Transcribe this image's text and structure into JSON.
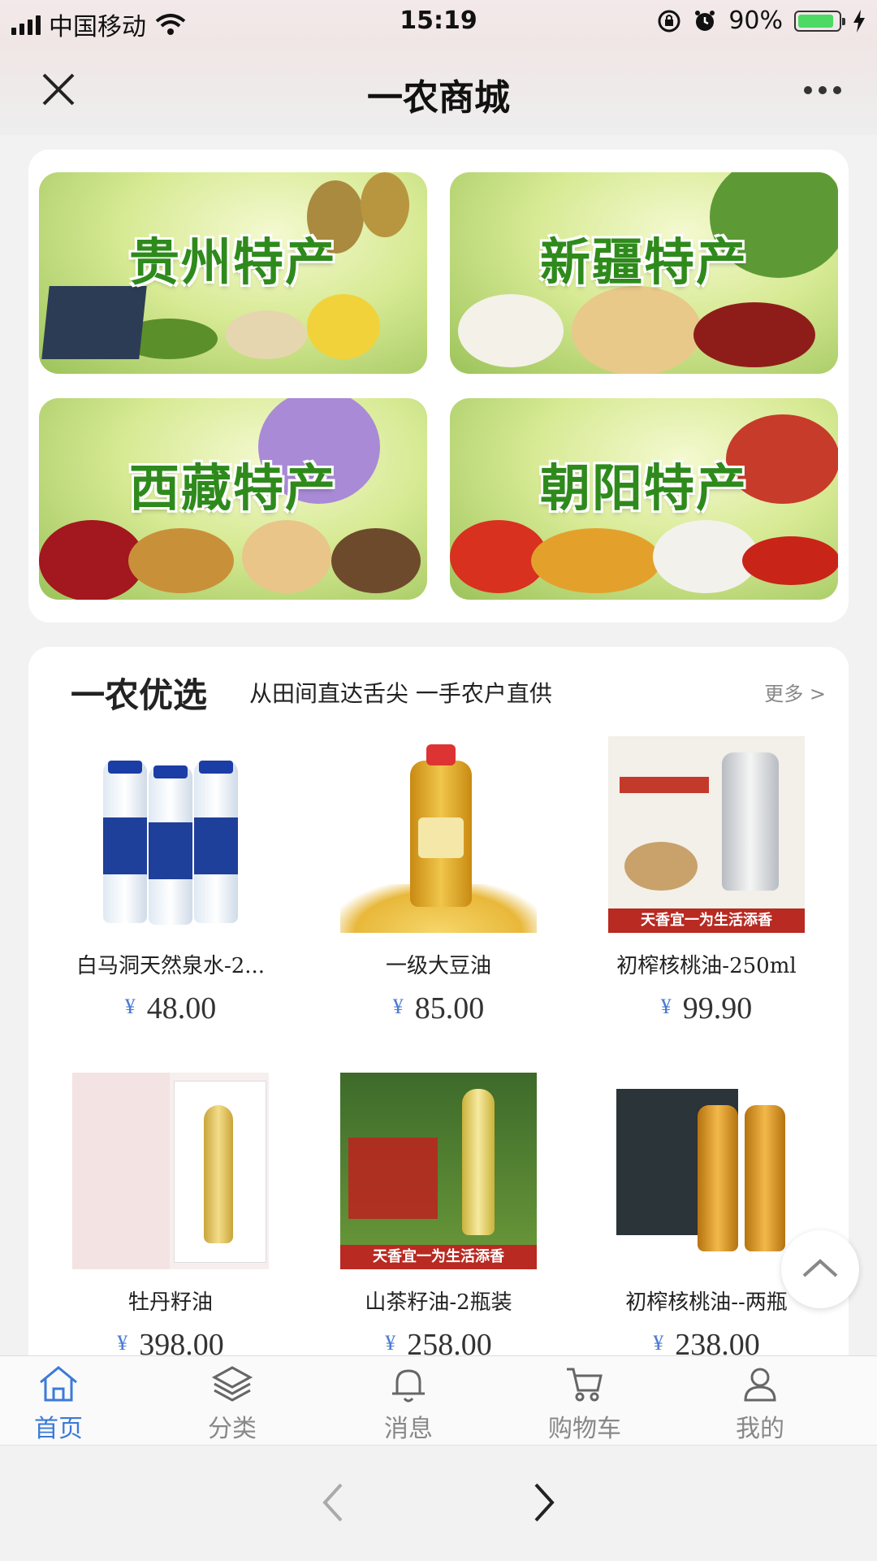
{
  "status_bar": {
    "carrier": "中国移动",
    "time": "15:19",
    "battery": "90%",
    "battery_level": 0.9
  },
  "nav": {
    "title": "一农商城"
  },
  "regions": [
    {
      "label": "贵州特产"
    },
    {
      "label": "新疆特产"
    },
    {
      "label": "西藏特产"
    },
    {
      "label": "朝阳特产"
    }
  ],
  "picks": {
    "title": "一农优选",
    "subtitle": "从田间直达舌尖 一手农户直供",
    "more": "更多 >",
    "banner_text": "天香宜一为生活添香",
    "products": [
      {
        "name": "白马洞天然泉水-2...",
        "currency": "¥",
        "price": "48.00"
      },
      {
        "name": "一级大豆油",
        "currency": "¥",
        "price": "85.00"
      },
      {
        "name": "初榨核桃油-250ml",
        "currency": "¥",
        "price": "99.90"
      },
      {
        "name": "牡丹籽油",
        "currency": "¥",
        "price": "398.00"
      },
      {
        "name": "山茶籽油-2瓶装",
        "currency": "¥",
        "price": "258.00"
      },
      {
        "name": "初榨核桃油--两瓶",
        "currency": "¥",
        "price": "238.00"
      }
    ]
  },
  "tabs": [
    {
      "label": "首页",
      "icon": "home-icon"
    },
    {
      "label": "分类",
      "icon": "layers-icon"
    },
    {
      "label": "消息",
      "icon": "bell-icon"
    },
    {
      "label": "购物车",
      "icon": "cart-icon"
    },
    {
      "label": "我的",
      "icon": "user-icon"
    }
  ],
  "colors": {
    "accent": "#3b7ad8",
    "region_text": "#2f8a1c",
    "price_currency": "#4a7bd0"
  }
}
